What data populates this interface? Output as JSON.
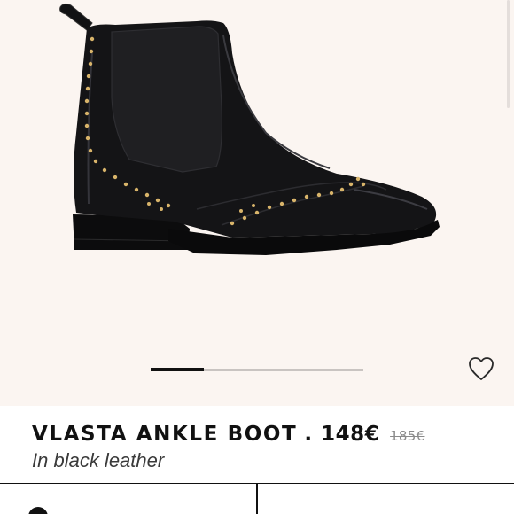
{
  "product": {
    "name": "VLASTA ANKLE BOOT",
    "separator": ".",
    "price": "148€",
    "old_price": "185€",
    "description": "In black leather"
  },
  "gallery": {
    "image_subject": "black leather chelsea ankle boot with gold studs",
    "current_slide": 1,
    "progress_fraction": 0.25
  },
  "icons": {
    "wishlist": "heart-outline-icon",
    "action": "circle-icon"
  },
  "colors": {
    "background": "#fbf5f1",
    "text": "#111111",
    "old_price": "#8a8a8a",
    "boot": "#141416",
    "studs": "#d8b46a"
  }
}
